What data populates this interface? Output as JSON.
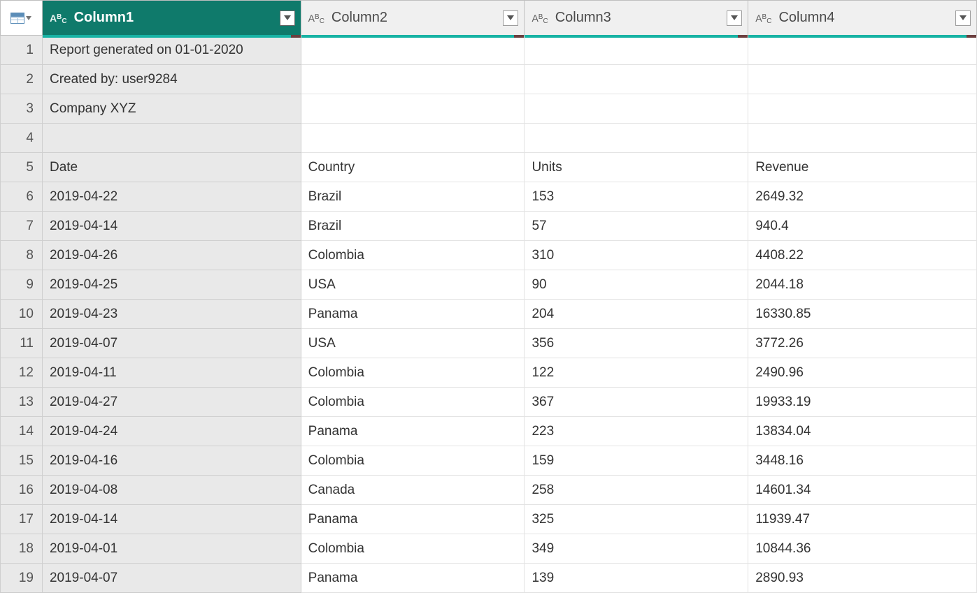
{
  "columns": [
    {
      "label": "Column1",
      "selected": true,
      "accent": true
    },
    {
      "label": "Column2",
      "selected": false,
      "accent": true
    },
    {
      "label": "Column3",
      "selected": false,
      "accent": true
    },
    {
      "label": "Column4",
      "selected": false,
      "accent": true
    }
  ],
  "rows": [
    {
      "n": "1",
      "c": [
        "Report generated on 01-01-2020",
        "",
        "",
        ""
      ]
    },
    {
      "n": "2",
      "c": [
        "Created by: user9284",
        "",
        "",
        ""
      ]
    },
    {
      "n": "3",
      "c": [
        "Company XYZ",
        "",
        "",
        ""
      ]
    },
    {
      "n": "4",
      "c": [
        "",
        "",
        "",
        ""
      ]
    },
    {
      "n": "5",
      "c": [
        "Date",
        "Country",
        "Units",
        "Revenue"
      ]
    },
    {
      "n": "6",
      "c": [
        "2019-04-22",
        "Brazil",
        "153",
        "2649.32"
      ]
    },
    {
      "n": "7",
      "c": [
        "2019-04-14",
        "Brazil",
        "57",
        "940.4"
      ]
    },
    {
      "n": "8",
      "c": [
        "2019-04-26",
        "Colombia",
        "310",
        "4408.22"
      ]
    },
    {
      "n": "9",
      "c": [
        "2019-04-25",
        "USA",
        "90",
        "2044.18"
      ]
    },
    {
      "n": "10",
      "c": [
        "2019-04-23",
        "Panama",
        "204",
        "16330.85"
      ]
    },
    {
      "n": "11",
      "c": [
        "2019-04-07",
        "USA",
        "356",
        "3772.26"
      ]
    },
    {
      "n": "12",
      "c": [
        "2019-04-11",
        "Colombia",
        "122",
        "2490.96"
      ]
    },
    {
      "n": "13",
      "c": [
        "2019-04-27",
        "Colombia",
        "367",
        "19933.19"
      ]
    },
    {
      "n": "14",
      "c": [
        "2019-04-24",
        "Panama",
        "223",
        "13834.04"
      ]
    },
    {
      "n": "15",
      "c": [
        "2019-04-16",
        "Colombia",
        "159",
        "3448.16"
      ]
    },
    {
      "n": "16",
      "c": [
        "2019-04-08",
        "Canada",
        "258",
        "14601.34"
      ]
    },
    {
      "n": "17",
      "c": [
        "2019-04-14",
        "Panama",
        "325",
        "11939.47"
      ]
    },
    {
      "n": "18",
      "c": [
        "2019-04-01",
        "Colombia",
        "349",
        "10844.36"
      ]
    },
    {
      "n": "19",
      "c": [
        "2019-04-07",
        "Panama",
        "139",
        "2890.93"
      ]
    }
  ]
}
